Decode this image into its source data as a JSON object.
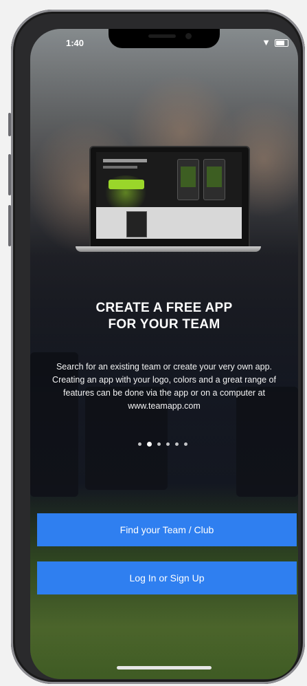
{
  "status_bar": {
    "time": "1:40",
    "wifi_icon": "wifi-icon",
    "battery_icon": "battery-icon"
  },
  "onboarding": {
    "headline_line1": "CREATE A FREE APP",
    "headline_line2": "FOR YOUR TEAM",
    "description": "Search for an existing team or create your very own app. Creating an app with your logo, colors and a great range of features can be done via the app or on a computer at www.teamapp.com",
    "page_indicator": {
      "total": 6,
      "active": 1
    }
  },
  "buttons": {
    "find_team": "Find your Team / Club",
    "login": "Log In or Sign Up"
  },
  "colors": {
    "primary_button": "#2f7ff0",
    "laptop_cta": "#9ad62a"
  }
}
